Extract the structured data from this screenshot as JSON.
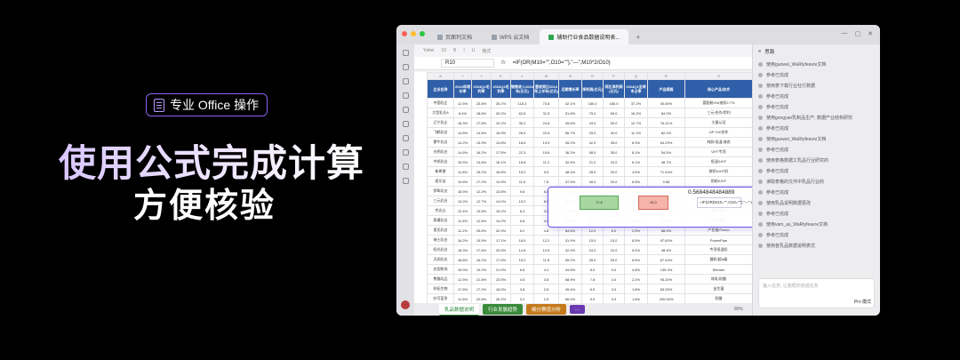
{
  "hero": {
    "badge_label": "专业 Office 操作",
    "headline": "使用公式完成计算",
    "subline": "方便核验"
  },
  "window": {
    "tabs": [
      {
        "label": "页面列文档"
      },
      {
        "label": "WPS 云文档"
      },
      {
        "label": "辅助行业食品数据说明表..."
      }
    ],
    "colors": {
      "red": "#ff5f57",
      "yellow": "#febc2e",
      "green": "#28c840"
    }
  },
  "sheet": {
    "toolbar_items": [
      "Yahei",
      "10",
      "B",
      "I",
      "U",
      "格式"
    ],
    "cell_ref": "R10",
    "fx": "fx",
    "formula": "=IF(OR(M10=\"\",O10=\"\"),\"—\",M10*2/O10)",
    "columns": [
      "A",
      "I",
      "J",
      "K",
      "L",
      "M",
      "N",
      "O",
      "P",
      "Q",
      "R",
      "S"
    ],
    "headers": [
      "企业名称",
      "2024年增长率",
      "2024Q1毛利率",
      "2024Q2毛利率",
      "销售收入2024年(亿元)",
      "营收同比2024年上半年(亿元)",
      "近期增长率",
      "净利润(亿元)",
      "同比净利润(亿元)",
      "2024Q1全球市占率",
      "产品规格",
      "核心产品/技术"
    ],
    "rows": [
      [
        "中国乳企",
        "12.5%",
        "23.8%",
        "25.1%",
        "118.3",
        "73.8",
        "42.1%",
        "180.0",
        "180.0",
        "37.2%",
        "40.89%",
        "婴配粉4%/液奶2.7%"
      ],
      [
        "大型乳业A",
        "8.4%",
        "18.8%",
        "20.2%",
        "62.8",
        "31.5",
        "51.8%",
        "75.0",
        "65.0",
        "16.2%",
        "84.0%",
        "三元/合作/伊利"
      ],
      [
        "辽宁乳企",
        "18.3%",
        "17.8%",
        "19.2%",
        "35.2",
        "24.8",
        "45.6%",
        "43.0",
        "50.0",
        "12.7%",
        "76.41%",
        "大量认证"
      ],
      [
        "飞鹤乳业",
        "14.8%",
        "14.8%",
        "15.9%",
        "28.5",
        "22.6",
        "56.7%",
        "33.0",
        "40.0",
        "11.1%",
        "82.2%",
        "UP 1%/合作"
      ],
      [
        "蒙牛乳业",
        "14.2%",
        "13.9%",
        "14.8%",
        "18.6",
        "13.5",
        "45.2%",
        "42.0",
        "35.0",
        "6.9%",
        "64.29%",
        "纯奶/低温/液态"
      ],
      [
        "光明乳业",
        "14.6%",
        "16.2%",
        "17.5%",
        "22.3",
        "15.8",
        "36.2%",
        "58.0",
        "35.0",
        "8.1%",
        "54.5%",
        "UHT专项"
      ],
      [
        "中邦乳业",
        "15.5%",
        "14.8%",
        "16.1%",
        "15.8",
        "11.2",
        "32.5%",
        "21.0",
        "24.0",
        "6.1%",
        "48.7%",
        "低温/UHT"
      ],
      [
        "新希望",
        "11.8%",
        "15.2%",
        "16.8%",
        "15.2",
        "9.5",
        "48.4%",
        "28.0",
        "20.0",
        "4.6%",
        "71.43%",
        "鲜奶/UHT奶"
      ],
      [
        "君乐宝",
        "13.8%",
        "17.2%",
        "14.5%",
        "11.6",
        "7.8",
        "37.5%",
        "45.0",
        "20.0",
        "6.5%",
        "0.56",
        "奶粉/UHT"
      ],
      [
        "伊犁乳业",
        "18.5%",
        "12.2%",
        "13.8%",
        "9.8",
        "6.8",
        "40.0%",
        "32.0",
        "25.0",
        "3.5%",
        "45.4%",
        "UHT/常温奶"
      ],
      [
        "三元乳业",
        "13.2%",
        "12.7%",
        "14.0%",
        "15.2",
        "8.5",
        "46.7%",
        "28.0",
        "20.0",
        "4.3%",
        "60.71%",
        "UHT/A2奶"
      ],
      [
        "完达山",
        "12.4%",
        "13.8%",
        "15.2%",
        "6.3",
        "3.5",
        "77.4%",
        "22.0",
        "18.0",
        "2.8%",
        "29.2%",
        "基础/低温"
      ],
      [
        "燕塘乳业",
        "11.5%",
        "12.8%",
        "14.2%",
        "5.8",
        "4.5",
        "55.2%",
        "15.0",
        "12.0",
        "2.5%",
        "40.0%",
        "UHT/常温"
      ],
      [
        "皇氏乳业",
        "11.2%",
        "25.8%",
        "32.9%",
        "5.2",
        "4.8",
        "84.6%",
        "12.0",
        "6.0",
        "2.5%",
        "88.9%",
        "产业链/Fonco"
      ],
      [
        "骑士乳业",
        "16.2%",
        "15.5%",
        "17.1%",
        "18.5",
        "12.2",
        "31.9%",
        "15.0",
        "15.0",
        "8.5%",
        "97.60%",
        "PowerPlan"
      ],
      [
        "阳光乳业",
        "18.3%",
        "17.8%",
        "20.5%",
        "14.8",
        "10.5",
        "42.9%",
        "24.0",
        "22.0",
        "5.4%",
        "48.4%",
        "专项低温奶"
      ],
      [
        "天润乳业",
        "18.8%",
        "16.2%",
        "17.5%",
        "15.2",
        "11.8",
        "55.2%",
        "35.0",
        "25.0",
        "6.6%",
        "67.43%",
        "酸奶/超A级"
      ],
      [
        "庄园牧场",
        "15.9%",
        "19.2%",
        "21.5%",
        "5.8",
        "4.2",
        "44.8%",
        "8.0",
        "9.0",
        "4.8%",
        "135.4%",
        "Elemen"
      ],
      [
        "熊猫乳品",
        "12.5%",
        "21.8%",
        "23.5%",
        "4.5",
        "3.8",
        "68.9%",
        "7.8",
        "4.0",
        "2.2%",
        "95.20%",
        "炼乳/奶酪"
      ],
      [
        "科拓生物",
        "17.8%",
        "17.2%",
        "18.5%",
        "3.8",
        "2.8",
        "45.4%",
        "6.0",
        "3.0",
        "1.8%",
        "83.33%",
        "益生菌"
      ],
      [
        "妙可蓝多",
        "11.5%",
        "22.8%",
        "26.2%",
        "3.2",
        "2.5",
        "56.5%",
        "5.0",
        "3.0",
        "1.8%",
        "200.00%",
        "奶酪"
      ]
    ],
    "calc_result": "0.5684848484889",
    "calc_formula": "=IF(OR(M10=\"\",O10=\"\"),\"—\",M10*2/O10)",
    "calc_g_value": "72.8",
    "calc_r_value": "45.0",
    "sheet_tabs": [
      {
        "label": "乳品数据说明",
        "color": "#ffffff"
      },
      {
        "label": "行业发展趋势",
        "color": "#3a8a3a"
      },
      {
        "label": "细分赛道分析",
        "color": "#c47a1c"
      },
      {
        "label": "...",
        "color": "#6b3ab0"
      }
    ],
    "zoom": "80%"
  },
  "assistant": {
    "title": "思路",
    "items": [
      "使用guowei_WaRtyfeavre文档",
      "参考已完成",
      "使用表下载行业社行数据",
      "参考已完成",
      "参考已完成",
      "使用gongyan乳制品生产, 数据产业结构研究",
      "参考已完成",
      "使用guowei_WaRtyfeavre文档",
      "参考已完成",
      "使用表格数据工乳品行业研究的",
      "参考已完成",
      "读取表格的文件中乳品行业的",
      "参考已完成",
      "使用乳品说明数据更改",
      "参考已完成",
      "使用vam_as_WaRtyfeavre文档",
      "参考已完成",
      "使用各乳品数据说明表式"
    ],
    "input_placeholder": "输入任务, 让我帮你完成任务",
    "mode": "Pro 模式"
  }
}
